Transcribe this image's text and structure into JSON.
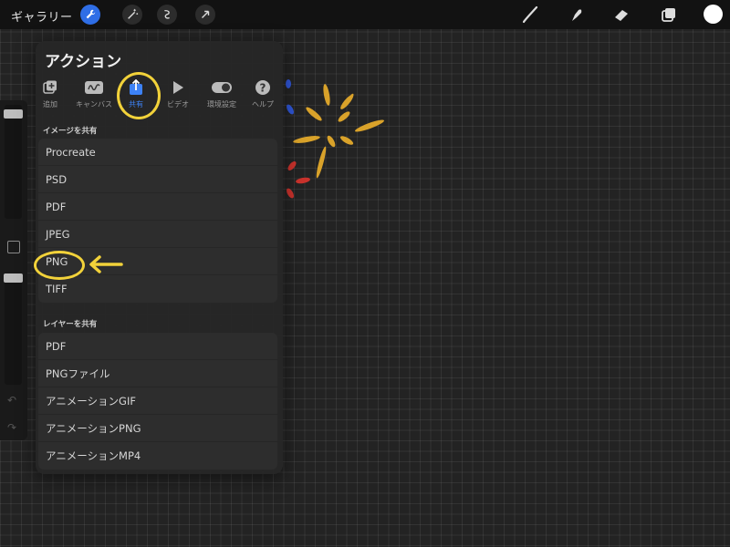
{
  "toolbar": {
    "gallery_label": "ギャラリー",
    "left_icons": [
      "wrench-icon",
      "magic-wand-icon",
      "selection-icon",
      "transform-arrow-icon"
    ],
    "right_icons": [
      "brush-icon",
      "smudge-icon",
      "eraser-icon",
      "layers-icon",
      "color-swatch"
    ],
    "accent": "#2f6ee6",
    "current_color": "#ffffff"
  },
  "panel": {
    "title": "アクション",
    "tabs": [
      {
        "label": "追加",
        "icon": "add-image-icon"
      },
      {
        "label": "キャンバス",
        "icon": "canvas-icon"
      },
      {
        "label": "共有",
        "icon": "share-icon",
        "active": true
      },
      {
        "label": "ビデオ",
        "icon": "play-icon"
      },
      {
        "label": "環境設定",
        "icon": "toggle-icon"
      },
      {
        "label": "ヘルプ",
        "icon": "help-icon"
      }
    ],
    "share_image": {
      "heading": "イメージを共有",
      "items": [
        "Procreate",
        "PSD",
        "PDF",
        "JPEG",
        "PNG",
        "TIFF"
      ]
    },
    "share_layers": {
      "heading": "レイヤーを共有",
      "items": [
        "PDF",
        "PNGファイル",
        "アニメーションGIF",
        "アニメーションPNG",
        "アニメーションMP4"
      ]
    }
  },
  "annotations": {
    "highlight_color": "#f2d23a",
    "highlighted": [
      "共有",
      "PNG"
    ]
  }
}
